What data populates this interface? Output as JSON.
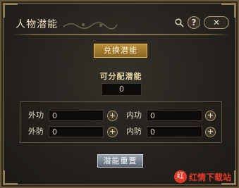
{
  "window": {
    "title": "人物潜能",
    "help_icon": "help-icon",
    "search_icon": "search-icon",
    "close_icon": "close-icon",
    "help_glyph": "?",
    "close_glyph": "✕"
  },
  "actions": {
    "exchange_label": "兑换潜能",
    "reset_label": "潜能重置"
  },
  "points": {
    "label": "可分配潜能",
    "value": "0"
  },
  "stats": [
    {
      "label": "外功",
      "value": "0"
    },
    {
      "label": "内功",
      "value": "0"
    },
    {
      "label": "外防",
      "value": "0"
    },
    {
      "label": "内防",
      "value": "0"
    }
  ],
  "plus_glyph": "+",
  "watermark": {
    "text": "红情下载站",
    "logo_glyph": "红"
  },
  "colors": {
    "gold_button": "#b88d3a",
    "reset_button": "#9aa3ad",
    "panel_border": "#8c7a55",
    "watermark": "#e43a2a"
  }
}
